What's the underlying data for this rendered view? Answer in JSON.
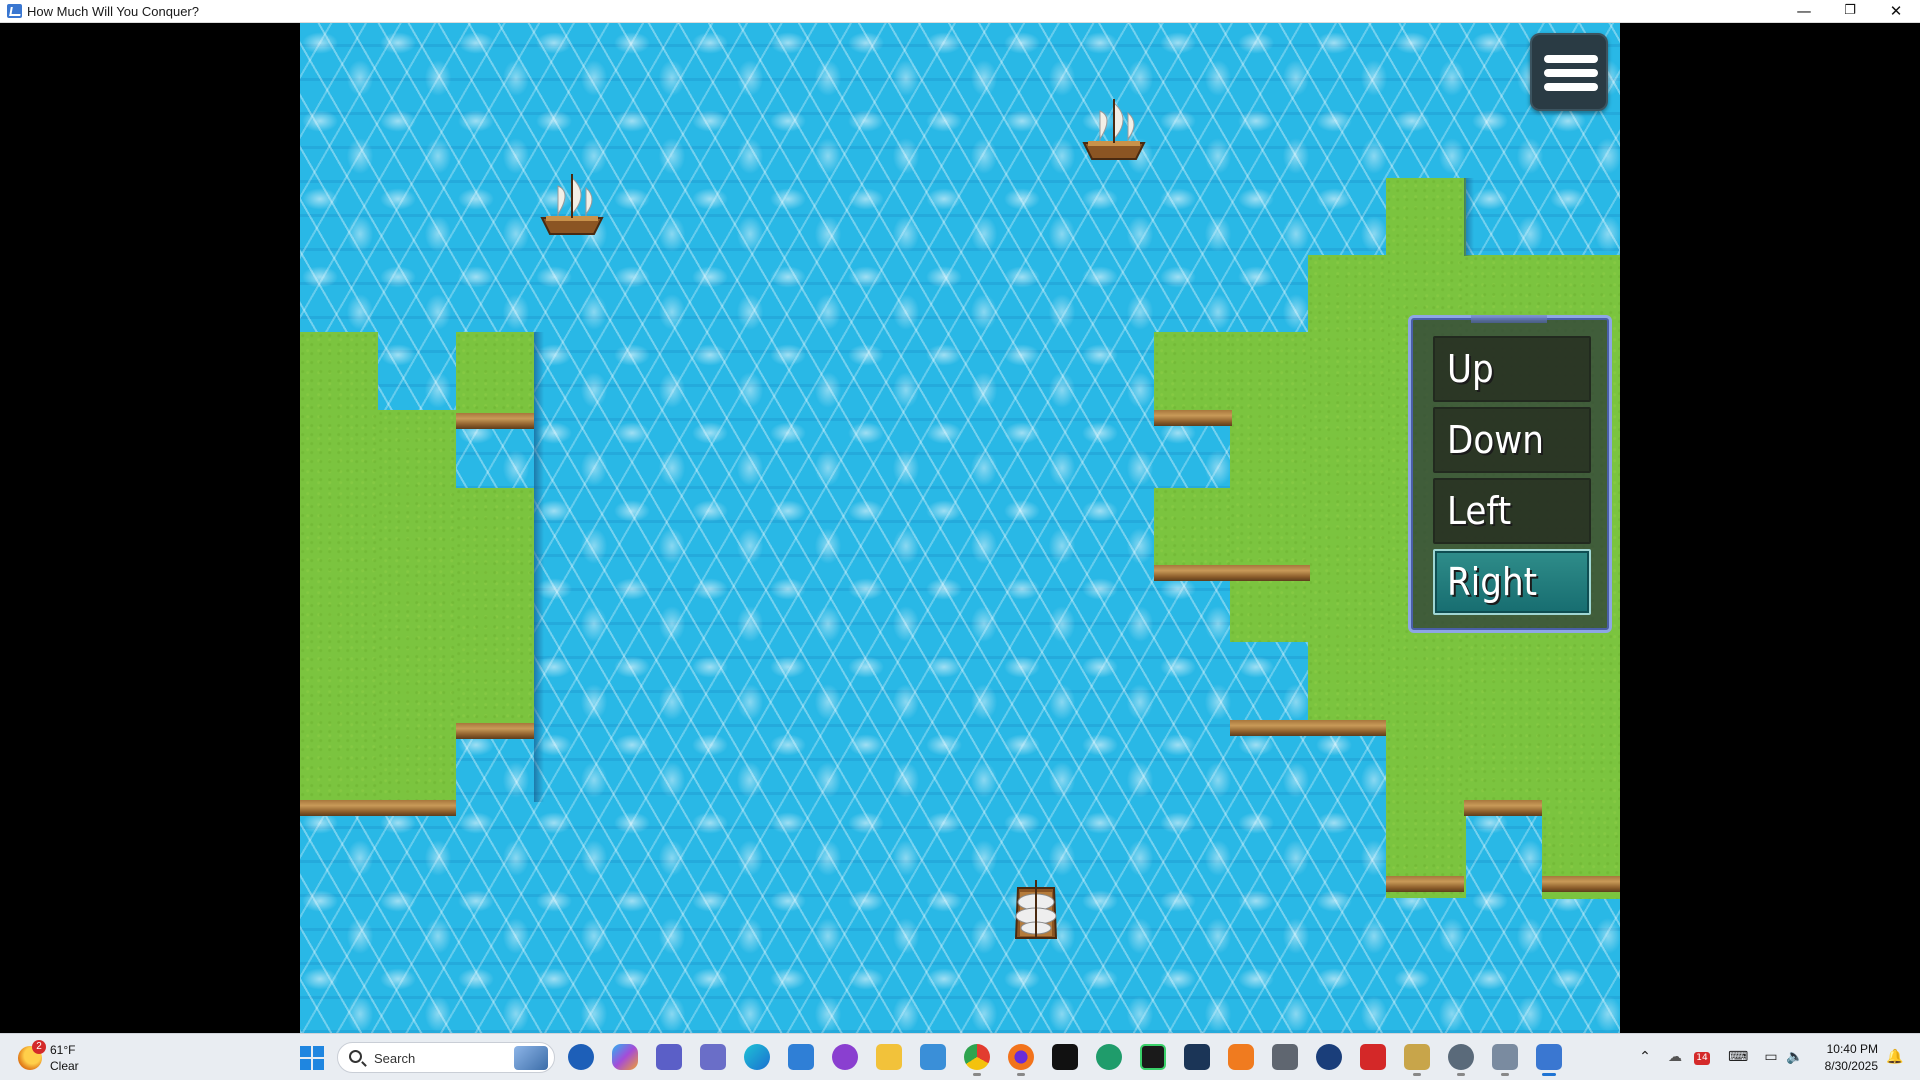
{
  "window": {
    "title": "How Much Will You Conquer?",
    "minimize_glyph": "—",
    "restore_glyph": "❐",
    "close_glyph": "✕"
  },
  "game": {
    "menu_button_icon": "hamburger-icon",
    "direction_menu": {
      "items": [
        "Up",
        "Down",
        "Left",
        "Right"
      ],
      "selected": "Right"
    },
    "ships": [
      "enemy-ship",
      "enemy-ship",
      "player-ship"
    ]
  },
  "taskbar": {
    "weather": {
      "temp": "61°F",
      "desc": "Clear",
      "badge": "2"
    },
    "search_placeholder": "Search",
    "clock": {
      "time": "10:40 PM",
      "date": "8/30/2025"
    },
    "tray_badge": "14",
    "tray_up_glyph": "⌃",
    "notify_glyph": "🔔"
  }
}
